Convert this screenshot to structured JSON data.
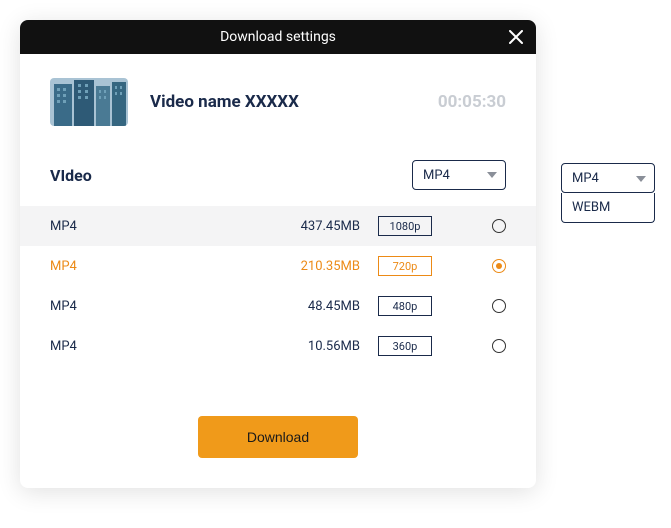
{
  "header": {
    "title": "Download settings"
  },
  "video": {
    "title": "Video name XXXXX",
    "duration": "00:05:30"
  },
  "section": {
    "label": "VIdeo"
  },
  "format_select": {
    "value": "MP4"
  },
  "rows": [
    {
      "format": "MP4",
      "size": "437.45MB",
      "res": "1080p"
    },
    {
      "format": "MP4",
      "size": "210.35MB",
      "res": "720p"
    },
    {
      "format": "MP4",
      "size": "48.45MB",
      "res": "480p"
    },
    {
      "format": "MP4",
      "size": "10.56MB",
      "res": "360p"
    }
  ],
  "download": {
    "label": "Download"
  },
  "external_dropdown": {
    "value": "MP4",
    "option": "WEBM"
  }
}
